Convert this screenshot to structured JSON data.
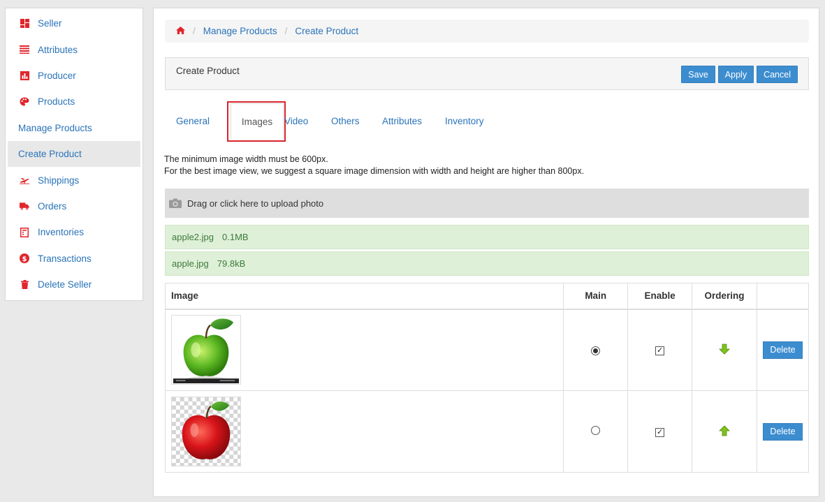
{
  "sidebar": {
    "items": [
      {
        "label": "Seller"
      },
      {
        "label": "Attributes"
      },
      {
        "label": "Producer"
      },
      {
        "label": "Products"
      },
      {
        "label": "Manage Products"
      },
      {
        "label": "Create Product"
      },
      {
        "label": "Shippings"
      },
      {
        "label": "Orders"
      },
      {
        "label": "Inventories"
      },
      {
        "label": "Transactions"
      },
      {
        "label": "Delete Seller"
      }
    ]
  },
  "breadcrumb": {
    "items": [
      "Manage Products",
      "Create Product"
    ],
    "separator": "/"
  },
  "panel": {
    "title": "Create Product",
    "save_label": "Save",
    "apply_label": "Apply",
    "cancel_label": "Cancel"
  },
  "tabs": [
    {
      "label": "General"
    },
    {
      "label": "Images"
    },
    {
      "label": "Video"
    },
    {
      "label": "Others"
    },
    {
      "label": "Attributes"
    },
    {
      "label": "Inventory"
    }
  ],
  "note": {
    "line1": "The minimum image width must be 600px.",
    "line2": "For the best image view, we suggest a square image dimension with width and height are higher than 800px."
  },
  "upload": {
    "label": "Drag or click here to upload photo"
  },
  "files": [
    {
      "name": "apple2.jpg",
      "size": "0.1MB"
    },
    {
      "name": "apple.jpg",
      "size": "79.8kB"
    }
  ],
  "table": {
    "headers": {
      "image": "Image",
      "main": "Main",
      "enable": "Enable",
      "ordering": "Ordering"
    },
    "rows": [
      {
        "delete_label": "Delete"
      },
      {
        "delete_label": "Delete"
      }
    ]
  },
  "colors": {
    "accent": "#3c8dd0",
    "link": "#2a73b8",
    "icon_red": "#e0262c",
    "success_bg": "#dff0d8"
  }
}
